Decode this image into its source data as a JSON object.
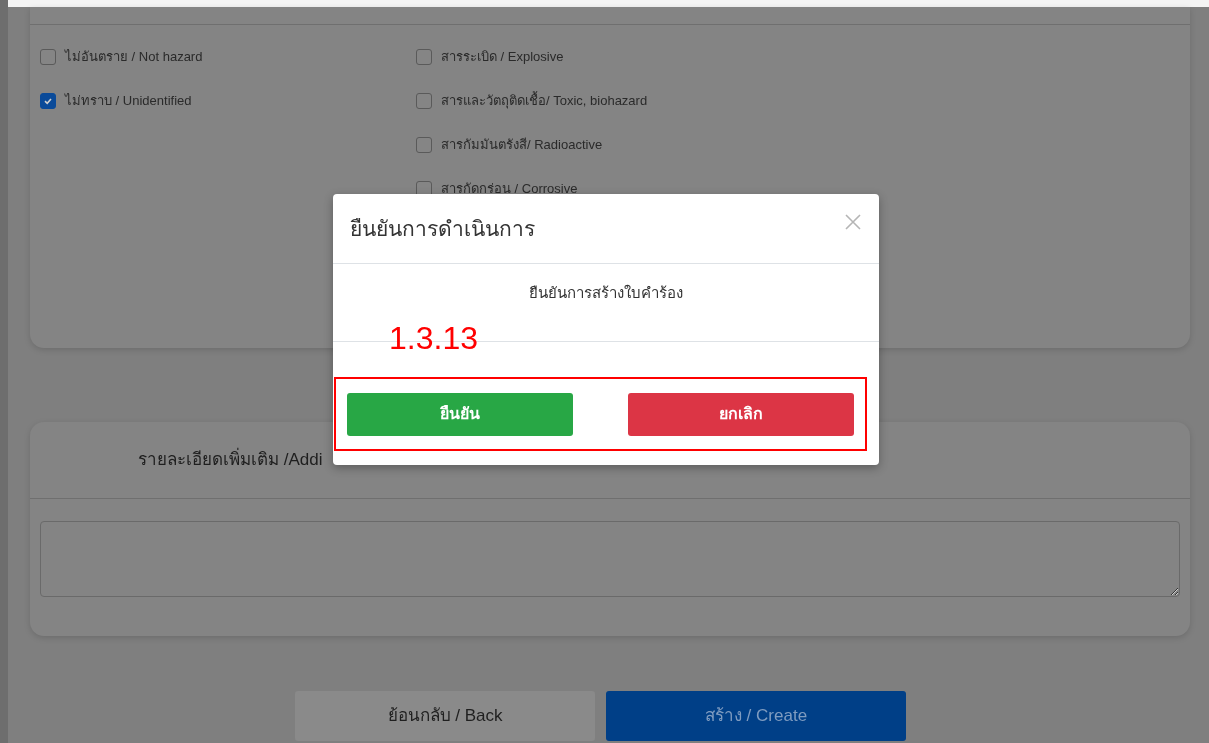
{
  "hazard_options": {
    "column_1": [
      {
        "label": "ไม่อันตราย / Not hazard",
        "checked": false
      },
      {
        "label": "ไม่ทราบ / Unidentified",
        "checked": true
      }
    ],
    "column_2": [
      {
        "label": "สารระเบิด / Explosive",
        "checked": false
      },
      {
        "label": "สารและวัตถุติดเชื้อ/ Toxic, biohazard",
        "checked": false
      },
      {
        "label": "สารกัมมันตรังสี/ Radioactive",
        "checked": false
      },
      {
        "label": "สารกัดกร่อน / Corrosive",
        "checked": false
      }
    ]
  },
  "details": {
    "label": "รายละเอียดเพิ่มเติม /Addi"
  },
  "actions": [
    {
      "label": "ย้อนกลับ / Back",
      "kind": "secondary"
    },
    {
      "label": "สร้าง / Create",
      "kind": "primary"
    }
  ],
  "dialog": {
    "title": "ยืนยันการดำเนินการ",
    "message": "ยืนยันการสร้างใบคำร้อง",
    "annotation": "1.3.13",
    "buttons": [
      {
        "label": "ยืนยัน",
        "kind": "confirm"
      },
      {
        "label": "ยกเลิก",
        "kind": "cancel"
      }
    ]
  }
}
